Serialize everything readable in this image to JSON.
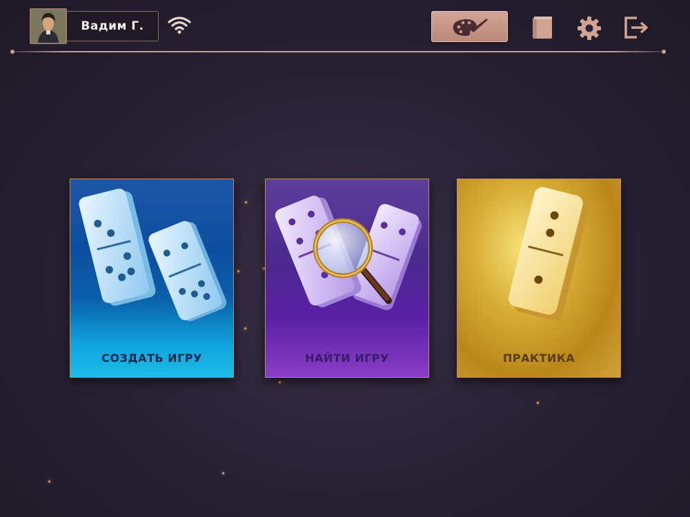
{
  "header": {
    "user_name": "Вадим Г.",
    "connection_icon": "wifi-icon",
    "customize_icon": "palette-icon",
    "book_icon": "book-icon",
    "settings_icon": "gear-icon",
    "exit_icon": "exit-icon"
  },
  "cards": [
    {
      "label": "СОЗДАТЬ ИГРУ",
      "icon": "dominoes-icon",
      "color": "#0d4e9e"
    },
    {
      "label": "НАЙТИ ИГРУ",
      "icon": "dominoes-magnifier-icon",
      "color": "#5a20a5"
    },
    {
      "label": "ПРАКТИКА",
      "icon": "gold-domino-icon",
      "color": "#d8ae37"
    }
  ],
  "colors": {
    "accent": "#c6a290",
    "background": "#2a2236"
  }
}
